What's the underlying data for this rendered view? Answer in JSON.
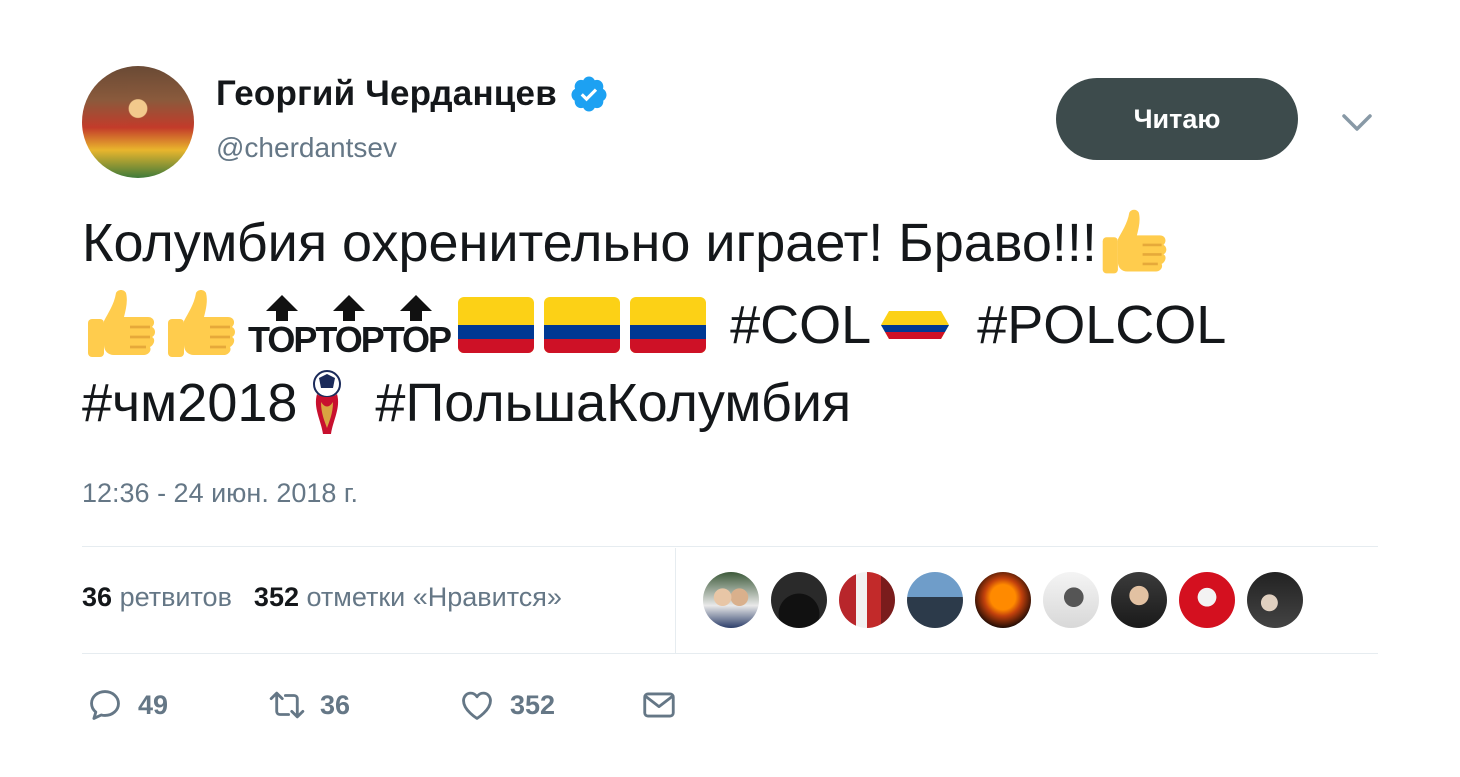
{
  "author": {
    "name": "Георгий Черданцев",
    "handle": "@cherdantsev",
    "verified": true
  },
  "follow_button_label": "Читаю",
  "tweet": {
    "line1_text": "Колумбия охренительно играет! Браво!!!",
    "top_label": "TOP",
    "hashtags": {
      "col": "#COL",
      "polcol": "#POLCOL",
      "wc": "#чм2018",
      "polska_col": "#ПольшаКолумбия"
    },
    "emoji": [
      "thumbs-up",
      "thumbs-up",
      "thumbs-up",
      "top-arrow",
      "top-arrow",
      "top-arrow",
      "colombia-flag",
      "colombia-flag",
      "colombia-flag",
      "colombia-hashflag",
      "world-cup-logo"
    ]
  },
  "timestamp": "12:36 - 24 июн. 2018 г.",
  "stats": {
    "retweets_count": "36",
    "retweets_label": "ретвитов",
    "likes_count": "352",
    "likes_label": "отметки «Нравится»"
  },
  "actions": {
    "replies": "49",
    "retweets": "36",
    "likes": "352"
  },
  "colors": {
    "follow_button_bg": "#3d4b4c",
    "verified_blue": "#1da1f2",
    "muted_text": "#657786",
    "colombia_yellow": "#fcd116",
    "colombia_blue": "#003893",
    "colombia_red": "#ce1126"
  }
}
